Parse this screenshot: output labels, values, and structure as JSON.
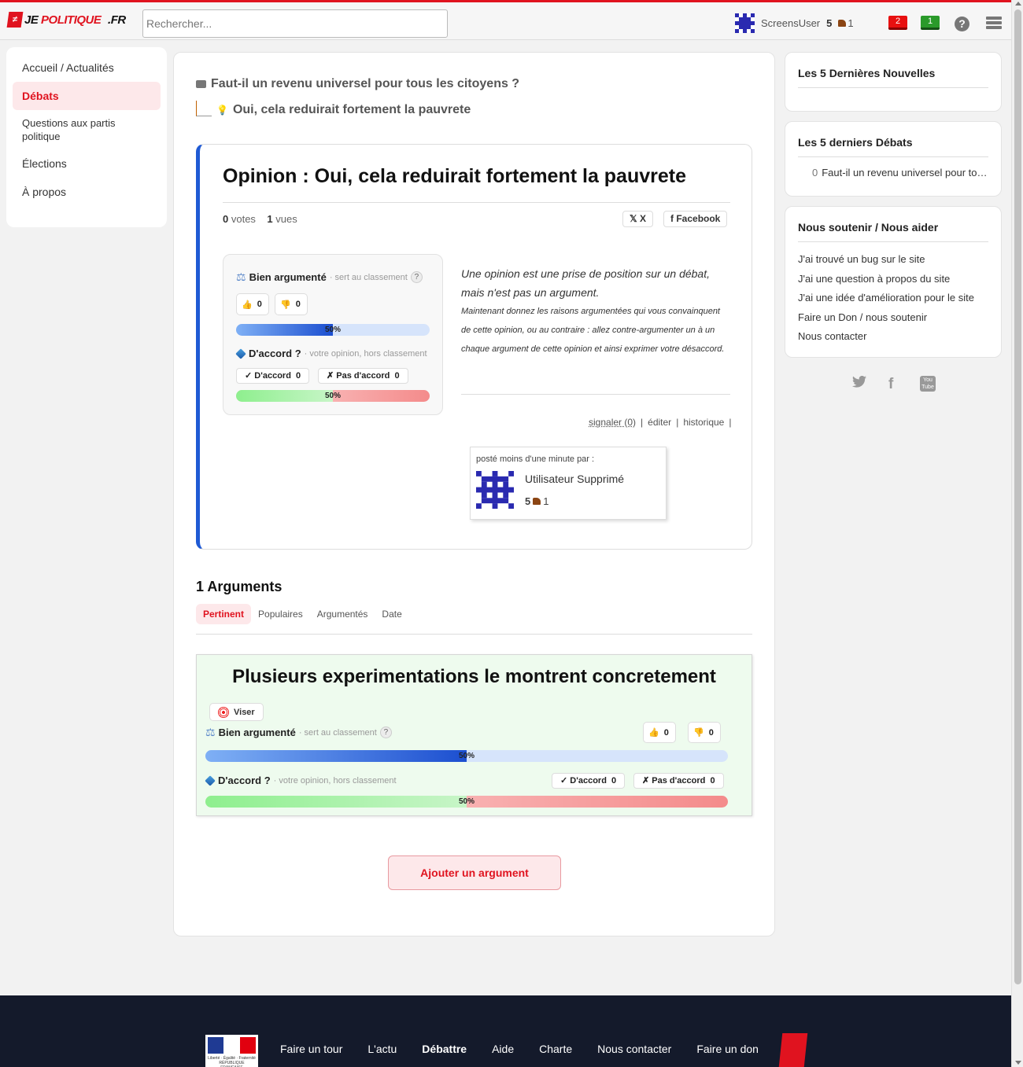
{
  "header": {
    "logo_text_je": "JE",
    "logo_text_politique": "POLITIQUE",
    "logo_text_fr": ".FR",
    "search_placeholder": "Rechercher...",
    "username": "ScreensUser",
    "score": "5",
    "boots": "1",
    "notif_red": "2",
    "notif_green": "1",
    "help_label": "?"
  },
  "nav": {
    "items": [
      {
        "label": "Accueil / Actualités"
      },
      {
        "label": "Débats"
      },
      {
        "label": "Questions aux partis politique"
      },
      {
        "label": "Élections"
      },
      {
        "label": "À propos"
      }
    ]
  },
  "breadcrumb": {
    "debate": "Faut-il un revenu universel pour tous les citoyens ?",
    "opinion": "Oui, cela reduirait fortement la pauvrete"
  },
  "opinion": {
    "title": "Opinion : Oui, cela reduirait fortement la pauvrete",
    "votes": "0",
    "votes_label": "votes",
    "views": "1",
    "views_label": "vues",
    "share_x": "X",
    "share_facebook": "Facebook",
    "quality_label": "Bien argumenté",
    "quality_hint": "· sert au classement",
    "up": "0",
    "down": "0",
    "quality_pct": "50%",
    "quality_fraction": 0.5,
    "agree_label": "D'accord ?",
    "agree_hint": "· votre opinion, hors classement",
    "agree_btn": "D'accord",
    "agree_count": "0",
    "disagree_btn": "Pas d'accord",
    "disagree_count": "0",
    "agree_pct": "50%",
    "agree_fraction": 0.5,
    "desc_lead": "Une opinion est une prise de position sur un débat, mais n'est pas un argument.",
    "desc_sub": "Maintenant donnez les raisons argumentées qui vous convainquent de cette opinion, ou au contraire : allez contre-argumenter un à un chaque argument de cette opinion et ainsi exprimer votre désaccord.",
    "action_report": "signaler (0)",
    "action_edit": "éditer",
    "action_history": "historique",
    "posted_label": "posté moins d'une minute par :",
    "author": "Utilisateur Supprimé",
    "author_score": "5",
    "author_boots": "1"
  },
  "arguments": {
    "count_label": "1 Arguments",
    "tabs": [
      {
        "label": "Pertinent"
      },
      {
        "label": "Populaires"
      },
      {
        "label": "Argumentés"
      },
      {
        "label": "Date"
      }
    ],
    "items": [
      {
        "title": "Plusieurs experimentations le montrent concretement",
        "viser": "Viser",
        "quality_label": "Bien argumenté",
        "quality_hint": "· sert au classement",
        "up": "0",
        "down": "0",
        "quality_pct": "50%",
        "quality_fraction": 0.5,
        "agree_label": "D'accord ?",
        "agree_hint": "· votre opinion, hors classement",
        "agree_btn": "D'accord",
        "agree_count": "0",
        "disagree_btn": "Pas d'accord",
        "disagree_count": "0",
        "agree_pct": "50%",
        "agree_fraction": 0.5
      }
    ],
    "add_button": "Ajouter un argument"
  },
  "sidebar": {
    "news_title": "Les 5 Dernières Nouvelles",
    "debates_title": "Les 5 derniers Débats",
    "debates": [
      {
        "count": "0",
        "label": "Faut-il un revenu universel pour tous les citoyens ?"
      }
    ],
    "support_title": "Nous soutenir / Nous aider",
    "support_links": [
      {
        "label": "J'ai trouvé un bug sur le site"
      },
      {
        "label": "J'ai une question à propos du site"
      },
      {
        "label": "J'ai une idée d'amélioration pour le site"
      },
      {
        "label": "Faire un Don / nous soutenir"
      },
      {
        "label": "Nous contacter"
      }
    ],
    "youtube_label": "You Tube"
  },
  "footer": {
    "links": [
      {
        "label": "Faire un tour"
      },
      {
        "label": "L'actu"
      },
      {
        "label": "Débattre"
      },
      {
        "label": "Aide"
      },
      {
        "label": "Charte"
      },
      {
        "label": "Nous contacter"
      },
      {
        "label": "Faire un don"
      }
    ],
    "flag_text": "Liberté · Égalité · Fraternité RÉPUBLIQUE FRANÇAISE"
  },
  "colors": {
    "brand_red": "#e0131f",
    "accent_blue": "#1f5ad4",
    "argument_bg": "#eefbee",
    "footer_bg": "#141a2b"
  },
  "icons": [
    "speech-bubble-icon",
    "bulb-icon",
    "scale-icon",
    "thumb-up-icon",
    "thumb-down-icon",
    "cube-icon",
    "target-icon",
    "help-icon",
    "menu-icon",
    "twitter-icon",
    "facebook-icon",
    "youtube-icon",
    "boot-icon"
  ]
}
